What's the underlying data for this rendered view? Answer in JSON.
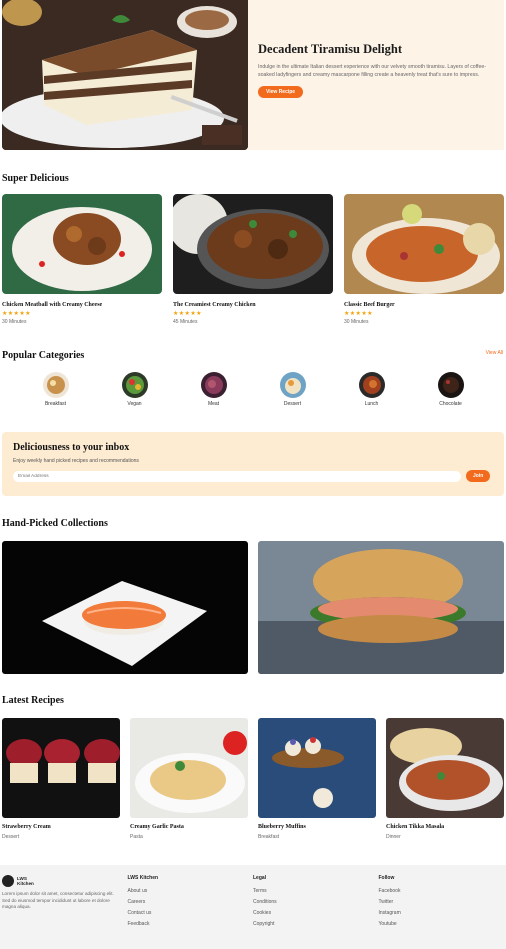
{
  "hero": {
    "title": "Decadent Tiramisu Delight",
    "description": "Indulge in the ultimate Italian dessert experience with our velvety smooth tiramisu. Layers of coffee-soaked ladyfingers and creamy mascarpone filling create a heavenly treat that's sure to impress.",
    "button": "View Recipe"
  },
  "super_delicious": {
    "heading": "Super Delicious",
    "cards": [
      {
        "title": "Chicken Meatball with Creamy Cheese",
        "stars": "★★★★★",
        "time": "30 Minutes"
      },
      {
        "title": "The Creamiest Creamy Chicken",
        "stars": "★★★★★",
        "time": "45 Minutes"
      },
      {
        "title": "Classic Beef Burger",
        "stars": "★★★★★",
        "time": "30 Minutes"
      }
    ]
  },
  "categories": {
    "heading": "Popular Categories",
    "view_all": "View All",
    "items": [
      "Breakfast",
      "Vegan",
      "Meat",
      "Dessert",
      "Lunch",
      "Chocolate"
    ]
  },
  "newsletter": {
    "title": "Deliciousness to your inbox",
    "subtitle": "Enjoy weekly hand picked recipes and recommendations",
    "placeholder": "Email Address",
    "button": "Join"
  },
  "hand_picked": {
    "heading": "Hand-Picked Collections"
  },
  "latest": {
    "heading": "Latest Recipes",
    "cards": [
      {
        "title": "Strawberry Cream",
        "category": "Dessert"
      },
      {
        "title": "Creamy Garlic Pasta",
        "category": "Pasta"
      },
      {
        "title": "Blueberry Muffins",
        "category": "Breakfast"
      },
      {
        "title": "Chicken Tikka Masala",
        "category": "Dinner"
      }
    ]
  },
  "footer": {
    "logo_line1": "LWS",
    "logo_line2": "Kitchen",
    "description": "Lorem ipsum dolor sit amet, consectetur adipiscing elit. Sed do eiusmod tempor incididunt ut labore et dolore magna aliqua.",
    "columns": [
      {
        "heading": "LWS Kitchen",
        "links": [
          "About us",
          "Careers",
          "Contact us",
          "Feedback"
        ]
      },
      {
        "heading": "Legal",
        "links": [
          "Terms",
          "Conditions",
          "Cookies",
          "Copyright"
        ]
      },
      {
        "heading": "Follow",
        "links": [
          "Facebook",
          "Twitter",
          "Instagram",
          "Youtube"
        ]
      }
    ]
  }
}
